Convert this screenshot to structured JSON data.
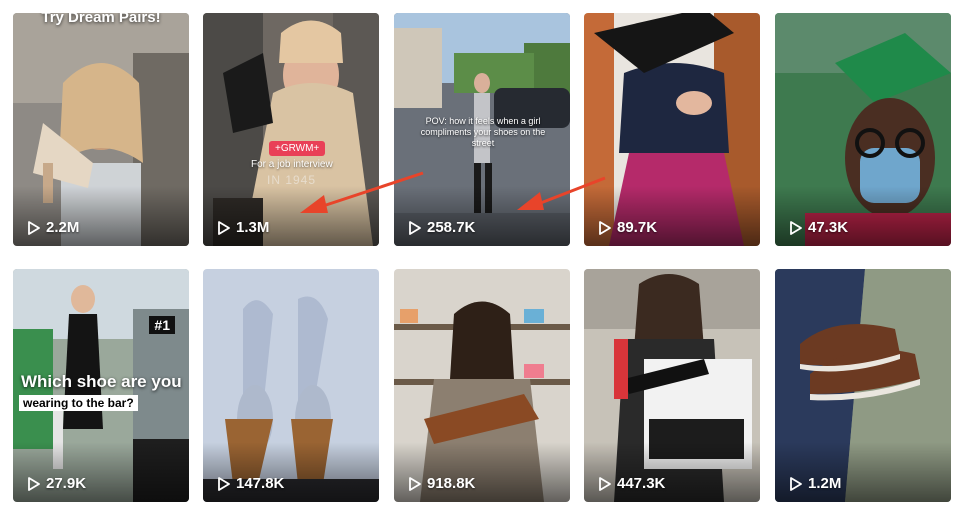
{
  "videos": [
    {
      "views": "2.2M",
      "overlay": "Try Dream Pairs!"
    },
    {
      "views": "1.3M",
      "badge": "+GRWM+",
      "caption": "For a job interview",
      "stamp": "IN 1945"
    },
    {
      "views": "258.7K",
      "caption": "POV: how it feels when a girl compliments your shoes on the street"
    },
    {
      "views": "89.7K"
    },
    {
      "views": "47.3K"
    },
    {
      "views": "27.9K",
      "badge": "#1",
      "caption_line1": "Which shoe are you",
      "caption_line2": "wearing to the bar?"
    },
    {
      "views": "147.8K"
    },
    {
      "views": "918.8K"
    },
    {
      "views": "447.3K"
    },
    {
      "views": "1.2M"
    }
  ],
  "colors": {
    "arrow": "#e8442a",
    "views_text": "#ffffff"
  },
  "icons": {
    "views": "play-icon"
  }
}
